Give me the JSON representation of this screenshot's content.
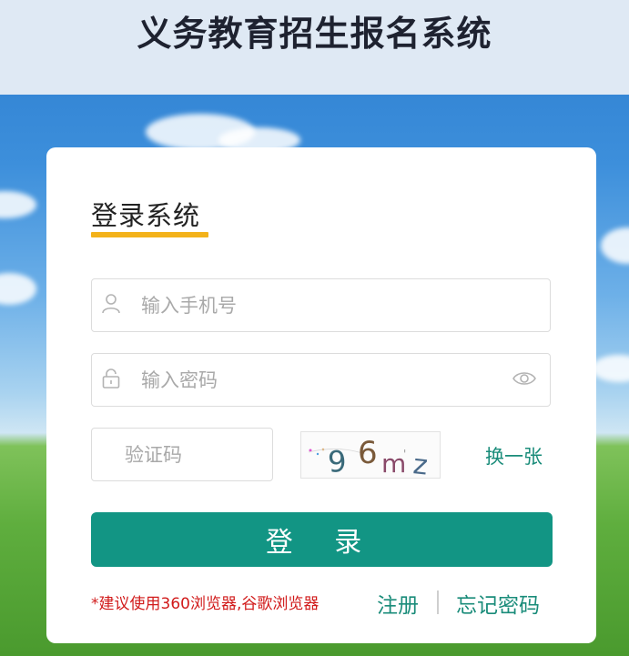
{
  "header": {
    "title": "义务教育招生报名系统"
  },
  "login": {
    "heading": "登录系统",
    "phone_placeholder": "输入手机号",
    "password_placeholder": "输入密码",
    "captcha_placeholder": "验证码",
    "captcha_text": "96mz",
    "refresh_label": "换一张",
    "submit_label": "登 录",
    "browser_notice": "*建议使用360浏览器,谷歌浏览器",
    "register_label": "注册",
    "forgot_label": "忘记密码"
  },
  "colors": {
    "accent": "#129584",
    "link": "#1a8c7a",
    "underline": "#f3b21a",
    "notice": "#d11a1a"
  },
  "icons": {
    "phone_field": "user-icon",
    "password_field": "lock-icon",
    "password_toggle": "eye-icon"
  }
}
